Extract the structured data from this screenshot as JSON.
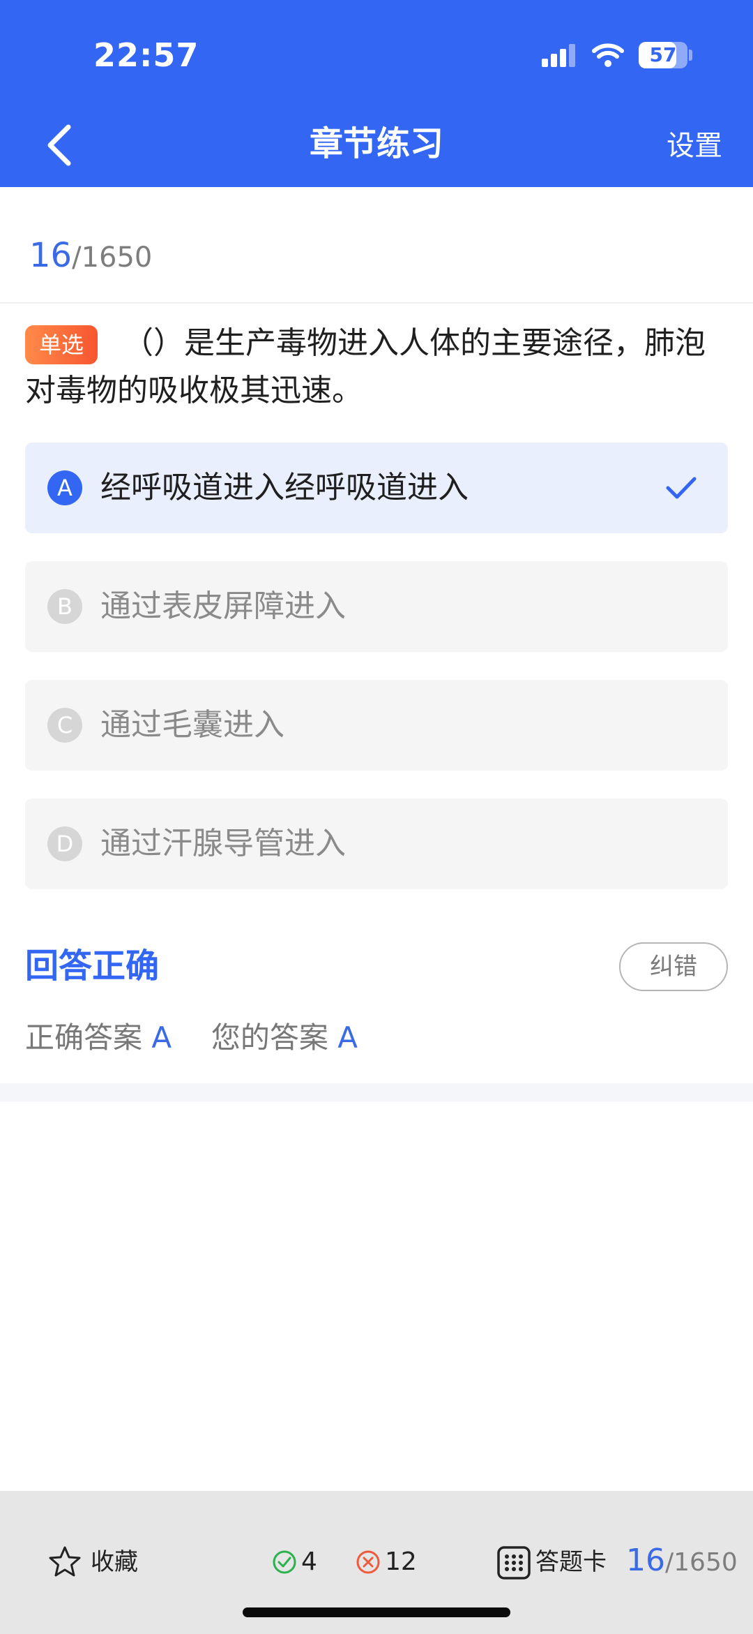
{
  "status_bar": {
    "time": "22:57",
    "battery": "57"
  },
  "header": {
    "title": "章节练习",
    "settings_label": "设置",
    "back_icon": "chevron-left-icon"
  },
  "progress": {
    "current": "16",
    "separator": "/",
    "total": "1650"
  },
  "question": {
    "type_badge": "单选",
    "text": "（）是生产毒物进入人体的主要途径，肺泡对毒物的吸收极其迅速。"
  },
  "options": [
    {
      "letter": "A",
      "text": "经呼吸道进入经呼吸道进入",
      "selected": true
    },
    {
      "letter": "B",
      "text": "通过表皮屏障进入",
      "selected": false
    },
    {
      "letter": "C",
      "text": "通过毛囊进入",
      "selected": false
    },
    {
      "letter": "D",
      "text": "通过汗腺导管进入",
      "selected": false
    }
  ],
  "result": {
    "title": "回答正确",
    "report_label": "纠错",
    "correct_label": "正确答案",
    "correct_value": "A",
    "your_label": "您的答案",
    "your_value": "A"
  },
  "bottom_bar": {
    "favorite_label": "收藏",
    "correct_count": "4",
    "wrong_count": "12",
    "answer_card_label": "答题卡",
    "current": "16",
    "separator": "/",
    "total": "1650"
  },
  "colors": {
    "primary": "#3366f2",
    "badge": "#f7562f",
    "correct": "#2bb24c",
    "wrong": "#f05a3c"
  }
}
